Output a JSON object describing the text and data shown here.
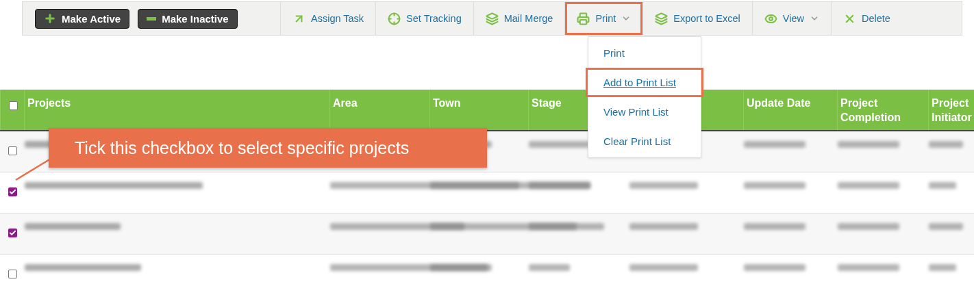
{
  "toolbar": [
    {
      "kind": "dark",
      "label": "Make Active"
    },
    {
      "kind": "dark",
      "label": "Make Inactive"
    },
    {
      "kind": "link",
      "label": "Assign Task",
      "highlighted": false,
      "caret": false
    },
    {
      "kind": "link",
      "label": "Set Tracking",
      "highlighted": false,
      "caret": false
    },
    {
      "kind": "link",
      "label": "Mail Merge",
      "highlighted": false,
      "caret": false
    },
    {
      "kind": "link",
      "label": "Print",
      "highlighted": true,
      "caret": true
    },
    {
      "kind": "link",
      "label": "Export to Excel",
      "highlighted": false,
      "caret": false
    },
    {
      "kind": "link",
      "label": "View",
      "highlighted": false,
      "caret": true
    },
    {
      "kind": "link",
      "label": "Delete",
      "highlighted": false,
      "caret": false
    }
  ],
  "print_menu": [
    {
      "label": "Print",
      "highlighted": false
    },
    {
      "label": "Add to Print List",
      "highlighted": true
    },
    {
      "label": "View Print List",
      "highlighted": false
    },
    {
      "label": "Clear Print List",
      "highlighted": false
    }
  ],
  "table": {
    "select_all_checked": false,
    "columns": [
      "Projects",
      "Area",
      "Town",
      "Stage",
      "",
      "Update Date",
      "Project Completion",
      "Project Initiator"
    ],
    "rows": [
      {
        "checked": false
      },
      {
        "checked": true
      },
      {
        "checked": true
      },
      {
        "checked": false
      }
    ]
  },
  "callout": "Tick this checkbox to select specific projects"
}
